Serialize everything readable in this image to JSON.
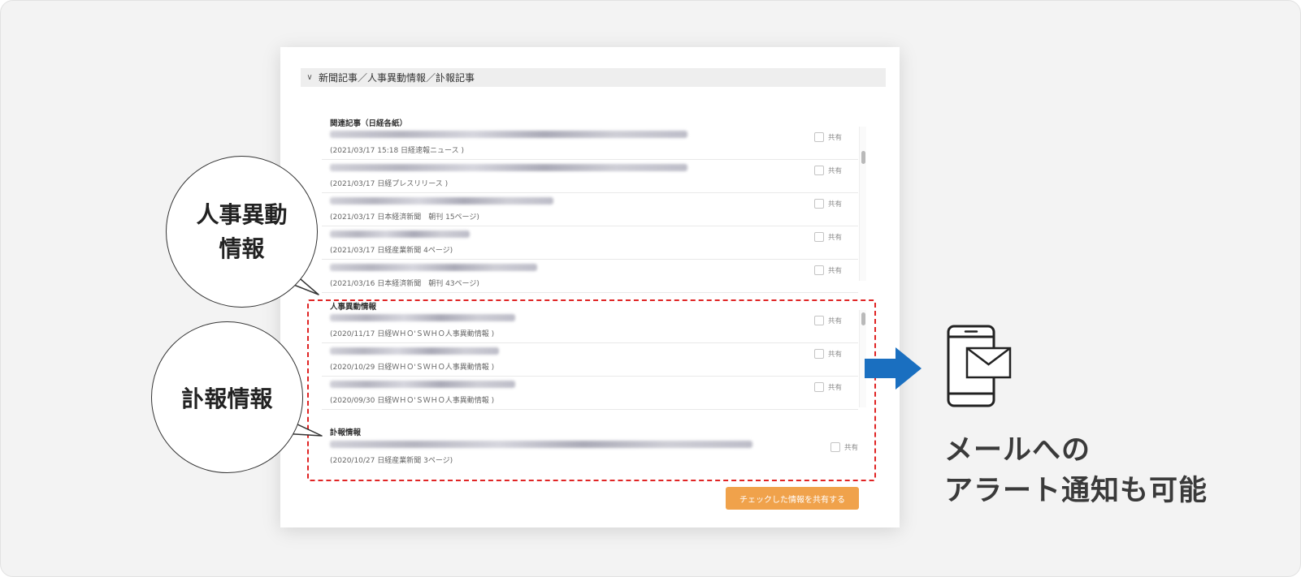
{
  "section": {
    "title": "新聞記事／人事異動情報／訃報記事"
  },
  "groups": {
    "related": {
      "title": "関連記事（日経各紙）",
      "rows": [
        {
          "meta": "(2021/03/17 15:18 日経速報ニュース )",
          "share": "共有"
        },
        {
          "meta": "(2021/03/17 日経プレスリリース )",
          "share": "共有"
        },
        {
          "meta": "(2021/03/17 日本経済新聞　朝刊 15ページ)",
          "share": "共有"
        },
        {
          "meta": "(2021/03/17 日経産業新聞 4ページ)",
          "share": "共有"
        },
        {
          "meta": "(2021/03/16 日本経済新聞　朝刊 43ページ)",
          "share": "共有"
        }
      ]
    },
    "personnel": {
      "title": "人事異動情報",
      "rows": [
        {
          "meta": "(2020/11/17 日経ＷＨＯ'ＳＷＨＯ人事異動情報 )",
          "share": "共有"
        },
        {
          "meta": "(2020/10/29 日経ＷＨＯ'ＳＷＨＯ人事異動情報 )",
          "share": "共有"
        },
        {
          "meta": "(2020/09/30 日経ＷＨＯ'ＳＷＨＯ人事異動情報 )",
          "share": "共有"
        }
      ]
    },
    "obituary": {
      "title": "訃報情報",
      "rows": [
        {
          "meta": "(2020/10/27 日経産業新聞 3ページ)",
          "share": "共有"
        }
      ]
    }
  },
  "share_button": "チェックした情報を共有する",
  "bubbles": {
    "personnel": {
      "line1": "人事異動",
      "line2": "情報"
    },
    "obituary": "訃報情報"
  },
  "notice": {
    "line1": "メールへの",
    "line2": "アラート通知も可能"
  },
  "colors": {
    "accent_button": "#f0a24b",
    "highlight_border": "#e02424",
    "arrow": "#1a6fc0",
    "icon_dark": "#222222"
  },
  "icons": [
    "chevron-down-icon",
    "arrow-right-icon",
    "smartphone-mail-icon"
  ]
}
